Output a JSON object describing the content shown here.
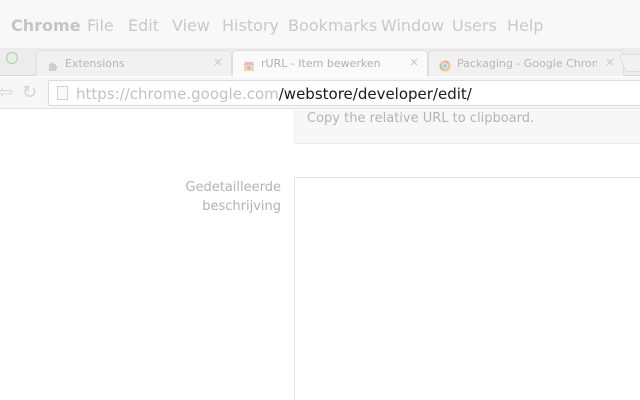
{
  "menu": {
    "app": "Chrome",
    "items": [
      "File",
      "Edit",
      "View",
      "History",
      "Bookmarks",
      "Window",
      "Users",
      "Help"
    ]
  },
  "tabs": [
    {
      "label": "Extensions",
      "icon": "puzzle-icon",
      "close": "×"
    },
    {
      "label": "rURL - Item bewerken",
      "icon": "webstore-icon",
      "close": "×"
    },
    {
      "label": "Packaging - Google Chrome",
      "icon": "chrome-icon",
      "close": "×"
    }
  ],
  "toolbar": {
    "back_icon": "⇦",
    "reload_icon": "↻",
    "url_host": "https://chrome.google.com",
    "url_path": "/webstore/developer/edit/"
  },
  "content": {
    "copy_hint": "Copy the relative URL to clipboard.",
    "detailed_label_line1": "Gedetailleerde",
    "detailed_label_line2": "beschrijving",
    "description_value": ""
  }
}
